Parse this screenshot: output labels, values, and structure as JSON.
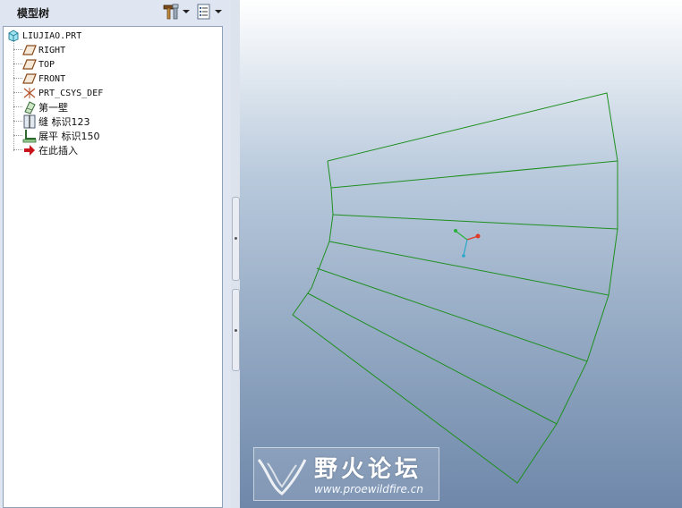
{
  "panel": {
    "title": "模型树",
    "tools": [
      {
        "icon": "hammer-wrench-icon"
      },
      {
        "icon": "list-view-icon"
      }
    ]
  },
  "tree": {
    "root": "LIUJIAO.PRT",
    "items": [
      {
        "label": "RIGHT",
        "icon": "datum-plane-icon",
        "mono": true
      },
      {
        "label": "TOP",
        "icon": "datum-plane-icon",
        "mono": true
      },
      {
        "label": "FRONT",
        "icon": "datum-plane-icon",
        "mono": true
      },
      {
        "label": "PRT_CSYS_DEF",
        "icon": "coordinate-system-icon",
        "mono": true
      },
      {
        "label": "第一壁",
        "icon": "sheetmetal-wall-icon",
        "mono": false
      },
      {
        "label": "缝 标识123",
        "icon": "rip-feature-icon",
        "mono": false
      },
      {
        "label": "展平 标识150",
        "icon": "unbend-feature-icon",
        "mono": false
      },
      {
        "label": "在此插入",
        "icon": "insert-here-arrow-icon",
        "mono": false
      }
    ]
  },
  "viewport": {
    "line_color": "#1f8f1f"
  },
  "watermark": {
    "title": "野火论坛",
    "url": "www.proewildfire.cn"
  }
}
